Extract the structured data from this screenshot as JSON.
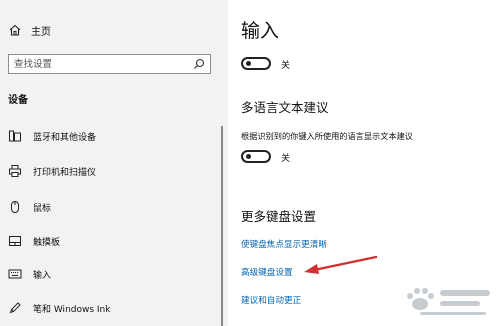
{
  "sidebar": {
    "home_label": "主页",
    "search_placeholder": "查找设置",
    "section_heading": "设备",
    "items": [
      {
        "label": "蓝牙和其他设备",
        "icon": "bluetooth-device-icon"
      },
      {
        "label": "打印机和扫描仪",
        "icon": "printer-icon"
      },
      {
        "label": "鼠标",
        "icon": "mouse-icon"
      },
      {
        "label": "触摸板",
        "icon": "touchpad-icon"
      },
      {
        "label": "输入",
        "icon": "keyboard-icon"
      },
      {
        "label": "笔和 Windows Ink",
        "icon": "pen-icon"
      }
    ]
  },
  "main": {
    "title": "输入",
    "typing_toggle": {
      "state_label": "关",
      "on": false
    },
    "multilingual": {
      "heading": "多语言文本建议",
      "description": "根据识别到的你键入所使用的语言显示文本建议",
      "toggle": {
        "state_label": "关",
        "on": false
      }
    },
    "more_keyboard": {
      "heading": "更多键盘设置",
      "links": [
        "使键盘焦点显示更清晰",
        "高级键盘设置",
        "建议和自动更正"
      ]
    }
  },
  "annotation": {
    "color": "#d32f2f",
    "icon": "red-arrow-icon"
  },
  "watermark": {
    "icon": "baidu-jingyan-watermark-icon"
  },
  "colors": {
    "sidebar_bg": "#f2f2f2",
    "link": "#0063b1",
    "toggle_off": "#222222"
  }
}
